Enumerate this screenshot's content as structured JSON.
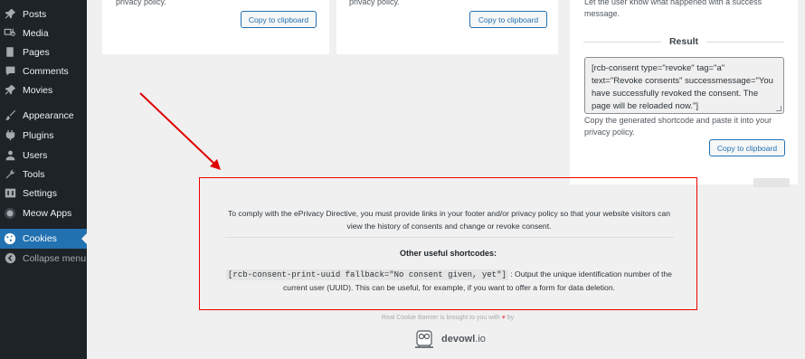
{
  "sidebar": {
    "items": [
      {
        "label": "Posts",
        "icon": "pin-icon"
      },
      {
        "label": "Media",
        "icon": "media-icon"
      },
      {
        "label": "Pages",
        "icon": "page-icon"
      },
      {
        "label": "Comments",
        "icon": "comment-icon"
      },
      {
        "label": "Movies",
        "icon": "pin-icon"
      },
      {
        "label": "Appearance",
        "icon": "brush-icon"
      },
      {
        "label": "Plugins",
        "icon": "plug-icon"
      },
      {
        "label": "Users",
        "icon": "user-icon"
      },
      {
        "label": "Tools",
        "icon": "wrench-icon"
      },
      {
        "label": "Settings",
        "icon": "settings-icon"
      },
      {
        "label": "Meow Apps",
        "icon": "meow-icon"
      },
      {
        "label": "Cookies",
        "icon": "cookie-icon"
      },
      {
        "label": "Collapse menu",
        "icon": "collapse-icon"
      }
    ],
    "active": "Cookies",
    "colors": {
      "bg": "#1d2327",
      "active": "#2271b1"
    }
  },
  "cards": [
    {
      "text": "privacy policy.",
      "button": "Copy to clipboard"
    },
    {
      "text": "privacy policy.",
      "button": "Copy to clipboard"
    }
  ],
  "result_card": {
    "top_text": "Let the user know what happened with a success message.",
    "heading": "Result",
    "shortcode": "[rcb-consent type=\"revoke\" tag=\"a\" text=\"Revoke consents\" successmessage=\"You have successfully revoked the consent. The page will be reloaded now.\"]",
    "hint": "Copy the generated shortcode and paste it into your privacy policy.",
    "button": "Copy to clipboard"
  },
  "info": {
    "paragraph": "To comply with the ePrivacy Directive, you must provide links in your footer and/or privacy policy so that your website visitors can view the history of consents and change or revoke consent.",
    "heading": "Other useful shortcodes:",
    "code": "[rcb-consent-print-uuid fallback=\"No consent given, yet\"]",
    "description": ": Output the unique identification number of the current user (UUID). This can be useful, for example, if you want to offer a form for data deletion."
  },
  "footer": {
    "credit_prefix": "Real Cookie Banner is brought to you with",
    "credit_suffix": "by",
    "brand_main": "devowl",
    "brand_tld": ".io"
  },
  "annotation": {
    "color": "#e00000"
  }
}
